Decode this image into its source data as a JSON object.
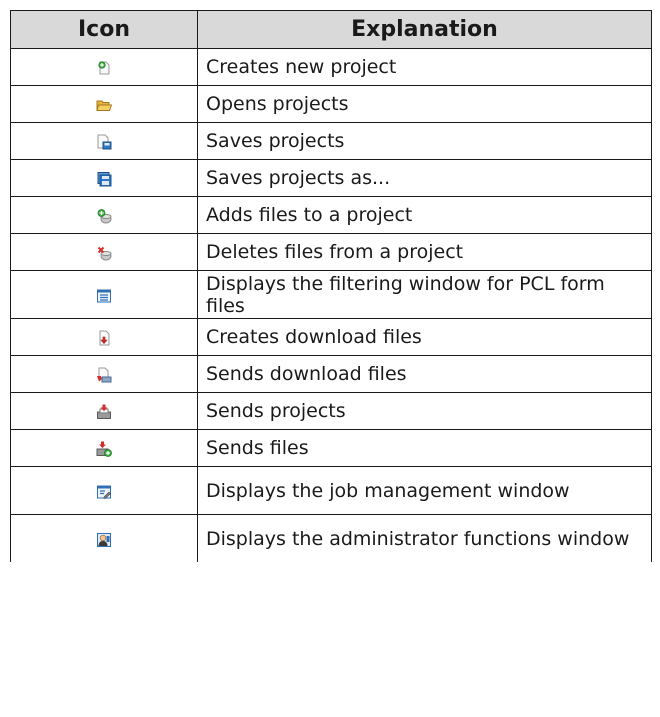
{
  "table": {
    "headers": {
      "icon": "Icon",
      "explanation": "Explanation"
    },
    "rows": [
      {
        "icon": "new-project-icon",
        "text": "Creates new project"
      },
      {
        "icon": "open-folder-icon",
        "text": "Opens projects"
      },
      {
        "icon": "save-icon",
        "text": "Saves projects"
      },
      {
        "icon": "save-as-icon",
        "text": "Saves projects as..."
      },
      {
        "icon": "add-files-icon",
        "text": "Adds files to a project"
      },
      {
        "icon": "delete-files-icon",
        "text": "Deletes files from a project"
      },
      {
        "icon": "filter-window-icon",
        "text": "Displays the filtering window for PCL form files"
      },
      {
        "icon": "create-download-icon",
        "text": "Creates download files"
      },
      {
        "icon": "send-download-icon",
        "text": "Sends download files"
      },
      {
        "icon": "send-projects-icon",
        "text": "Sends projects"
      },
      {
        "icon": "send-files-icon",
        "text": "Sends files"
      },
      {
        "icon": "job-management-icon",
        "text": "Displays the job management window"
      },
      {
        "icon": "administrator-icon",
        "text": "Displays the administrator functions window"
      }
    ]
  },
  "colors": {
    "header_bg": "#d9d9d9",
    "border": "#1a1a1a",
    "text": "#1a1a1a"
  }
}
